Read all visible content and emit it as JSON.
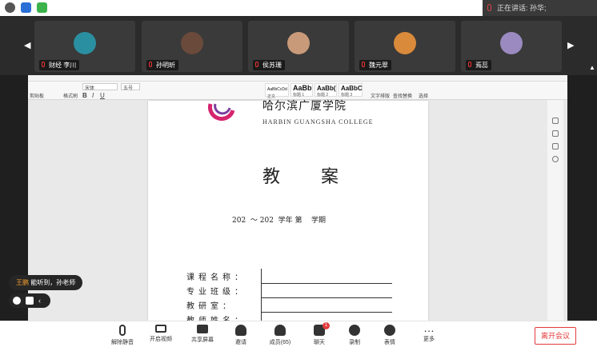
{
  "speaking": {
    "label": "正在讲话: 孙华;"
  },
  "participants": [
    {
      "name": "财经 李川",
      "color": "#2a8fa0"
    },
    {
      "name": "孙明昕",
      "color": "#6a4a3a"
    },
    {
      "name": "侯苏珊",
      "color": "#c89a7a"
    },
    {
      "name": "魏元翠",
      "color": "#d98a3a"
    },
    {
      "name": "焉蕊",
      "color": "#9a8ac0"
    }
  ],
  "word": {
    "ribbon_labels": [
      "剪贴板",
      "格式刷",
      "宋体",
      "五号",
      "正文",
      "标题 1",
      "标题 2",
      "标题 3",
      "文字排版",
      "查找替换",
      "选择"
    ],
    "styles": [
      {
        "sample": "AaBbCcDd",
        "name": "正文"
      },
      {
        "sample": "AaBb",
        "name": "标题 1"
      },
      {
        "sample": "AaBb(",
        "name": "标题 2"
      },
      {
        "sample": "AaBbC",
        "name": "标题 3"
      }
    ]
  },
  "document": {
    "college_cn": "哈尔滨广厦学院",
    "college_en": "HARBIN GUANGSHA COLLEGE",
    "title": "教 案",
    "term": "202  ～ 202  学年 第    学期",
    "fields": [
      "课程名称：",
      "专业班级：",
      "教研室：",
      "教师姓名："
    ]
  },
  "chat": {
    "who": "王鹏",
    "message": "能听到，孙老师"
  },
  "toolbar": {
    "items": [
      "解除静音",
      "开启视频",
      "共享屏幕",
      "邀请",
      "成员(65)",
      "聊天",
      "录制",
      "表情",
      "更多"
    ],
    "chat_badge": "1",
    "leave": "离开会议"
  },
  "colors": {
    "leave": "#e23b3b",
    "accent": "#f39c32"
  }
}
